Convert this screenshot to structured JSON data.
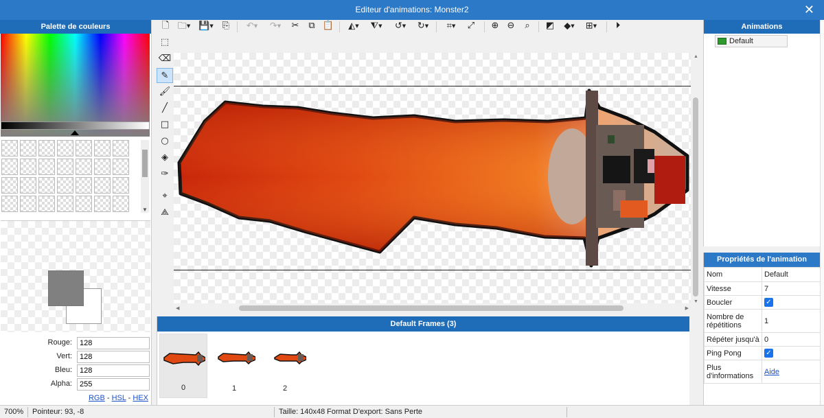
{
  "window": {
    "title": "Editeur d'animations: Monster2",
    "close_glyph": "✕"
  },
  "palette": {
    "title": "Palette de couleurs",
    "current_color": "#808080",
    "secondary_color": "#ffffff",
    "fields": [
      {
        "label": "Rouge:",
        "value": "128"
      },
      {
        "label": "Vert:",
        "value": "128"
      },
      {
        "label": "Bleu:",
        "value": "128"
      },
      {
        "label": "Alpha:",
        "value": "255"
      }
    ],
    "modes": {
      "rgb": "RGB",
      "hsl": "HSL",
      "hex": "HEX",
      "sep": " - "
    }
  },
  "toolbar": {
    "icons": [
      "new-file-icon",
      "open-folder-icon",
      "save-icon",
      "export-icon",
      "undo-icon",
      "redo-icon",
      "cut-icon",
      "copy-icon",
      "paste-icon",
      "flip-horizontal-icon",
      "flip-vertical-icon",
      "rotate-ccw-icon",
      "rotate-cw-icon",
      "crop-icon",
      "resize-icon",
      "zoom-in-icon",
      "zoom-out-icon",
      "zoom-reset-icon",
      "onion-skin-icon",
      "layers-icon",
      "grid-icon",
      "play-icon"
    ]
  },
  "tools": [
    "select-rect-icon",
    "eraser-icon",
    "pencil-icon",
    "brush-icon",
    "line-icon",
    "rectangle-icon",
    "ellipse-icon",
    "fill-bucket-icon",
    "eyedropper-icon",
    "origin-point-icon",
    "polygon-point-icon"
  ],
  "frames": {
    "title": "Default Frames (3)",
    "items": [
      {
        "label": "0"
      },
      {
        "label": "1"
      },
      {
        "label": "2"
      }
    ]
  },
  "animations": {
    "title": "Animations",
    "items": [
      {
        "label": "Default"
      }
    ]
  },
  "properties": {
    "title": "Propriétés de l'animation",
    "rows": [
      {
        "key": "Nom",
        "value": "Default"
      },
      {
        "key": "Vitesse",
        "value": "7"
      },
      {
        "key": "Boucler",
        "checked": true
      },
      {
        "key": "Nombre de répétitions",
        "value": "1"
      },
      {
        "key": "Répéter jusqu'à",
        "value": "0"
      },
      {
        "key": "Ping Pong",
        "checked": true
      },
      {
        "key": "Plus d'informations",
        "link": "Aide"
      }
    ]
  },
  "status": {
    "zoom": "700%",
    "pointer": "Pointeur: 93, -8",
    "size": "Taille: 140x48",
    "format": "Format D'export: Sans Perte"
  },
  "colors": {
    "accent": "#2b79c7",
    "panel_header": "#1f6cb8"
  }
}
